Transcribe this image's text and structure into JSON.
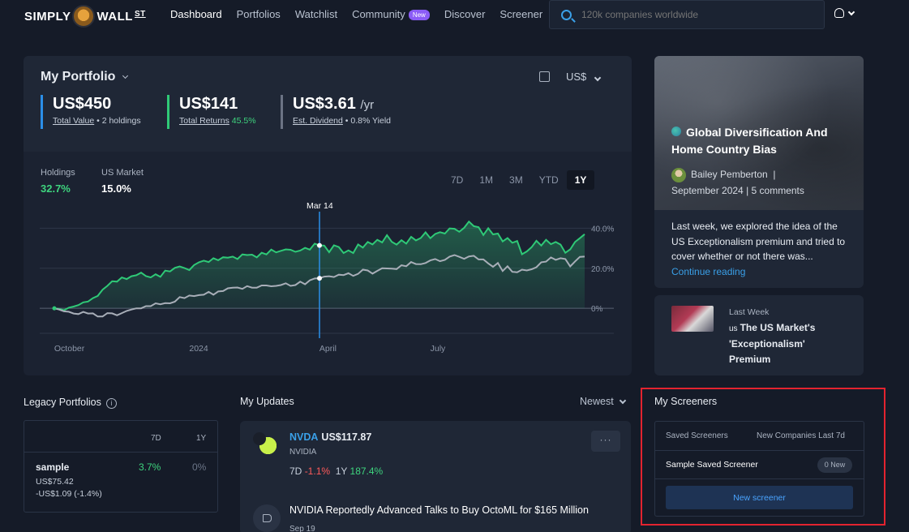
{
  "nav": {
    "logo_left": "SIMPLY",
    "logo_right": "WALL",
    "logo_st": "ST",
    "links": [
      "Dashboard",
      "Portfolios",
      "Watchlist",
      "Community",
      "Discover",
      "Screener"
    ],
    "community_badge": "New",
    "search_placeholder": "120k companies worldwide"
  },
  "portfolio": {
    "title": "My Portfolio",
    "currency": "US$",
    "total_value": "US$450",
    "total_value_label": "Total Value",
    "holdings_count": "• 2 holdings",
    "total_returns": "US$141",
    "total_returns_label": "Total Returns",
    "total_returns_pct": "45.5%",
    "dividend": "US$3.61",
    "dividend_suffix": "/yr",
    "dividend_label": "Est. Dividend",
    "dividend_yield": "• 0.8% Yield",
    "holdings_label": "Holdings",
    "holdings_pct": "32.7%",
    "market_label": "US Market",
    "market_pct": "15.0%",
    "ranges": [
      "7D",
      "1M",
      "3M",
      "YTD",
      "1Y"
    ],
    "selected_range": "1Y"
  },
  "chart_data": {
    "type": "line",
    "x_tick_labels": [
      "October",
      "2024",
      "April",
      "July"
    ],
    "y_tick_labels": [
      "40.0%",
      "20.0%",
      "0%"
    ],
    "ylim": [
      -6,
      45
    ],
    "hover_label": "Mar 14",
    "hover_index": 55,
    "series": [
      {
        "name": "Holdings",
        "color": "#2fc977",
        "values": [
          0.0,
          -0.3,
          -1.0,
          0.3,
          0.9,
          1.6,
          3.0,
          3.4,
          5.1,
          6.2,
          9.3,
          11.2,
          13.5,
          13.3,
          15.4,
          14.6,
          16.0,
          16.5,
          17.8,
          16.1,
          15.4,
          17.0,
          15.7,
          18.8,
          18.4,
          20.2,
          20.9,
          20.1,
          19.1,
          21.6,
          23.0,
          23.8,
          23.1,
          25.0,
          24.0,
          25.5,
          25.3,
          25.8,
          24.6,
          26.9,
          26.6,
          26.8,
          25.4,
          27.7,
          26.9,
          29.3,
          27.9,
          28.7,
          29.4,
          29.2,
          28.2,
          28.8,
          30.2,
          29.3,
          32.3,
          31.4,
          31.3,
          28.0,
          31.5,
          30.6,
          27.6,
          28.9,
          27.6,
          31.9,
          30.3,
          33.1,
          31.9,
          34.2,
          32.9,
          36.5,
          33.2,
          31.8,
          34.0,
          32.3,
          35.7,
          33.9,
          35.1,
          37.9,
          35.0,
          37.1,
          38.0,
          37.3,
          39.9,
          39.7,
          38.2,
          40.2,
          43.3,
          41.0,
          40.5,
          36.6,
          40.0,
          36.9,
          37.3,
          33.4,
          35.1,
          32.7,
          33.6,
          27.0,
          28.4,
          30.5,
          33.7,
          31.3,
          34.2,
          32.0,
          33.1,
          31.8,
          27.7,
          29.4,
          33.1,
          35.0,
          37.0
        ]
      },
      {
        "name": "US Market",
        "color": "#a8aeb8",
        "values": [
          0.0,
          -0.6,
          -1.5,
          -1.7,
          -2.6,
          -2.9,
          -1.8,
          -2.6,
          -2.5,
          -4.1,
          -4.1,
          -2.4,
          -2.5,
          -3.5,
          -2.4,
          -1.3,
          -0.6,
          0.0,
          0.0,
          1.1,
          1.1,
          2.5,
          2.0,
          2.6,
          2.5,
          3.3,
          5.6,
          5.1,
          6.4,
          6.1,
          6.6,
          6.8,
          8.2,
          6.8,
          8.4,
          8.6,
          10.0,
          10.3,
          10.4,
          9.7,
          11.1,
          10.3,
          10.3,
          11.4,
          11.4,
          11.0,
          11.2,
          11.6,
          12.5,
          11.2,
          11.6,
          13.3,
          12.0,
          14.0,
          14.9,
          15.0,
          15.8,
          16.0,
          15.6,
          16.8,
          16.6,
          17.5,
          16.2,
          17.2,
          19.3,
          18.9,
          17.3,
          18.7,
          20.0,
          19.9,
          19.8,
          19.6,
          21.5,
          21.0,
          23.1,
          22.1,
          22.0,
          22.6,
          23.9,
          24.6,
          23.5,
          24.2,
          25.8,
          26.6,
          25.7,
          24.7,
          25.9,
          26.2,
          24.4,
          24.4,
          22.4,
          20.7,
          22.6,
          18.6,
          21.0,
          18.2,
          18.0,
          19.3,
          18.9,
          19.5,
          20.5,
          23.0,
          23.3,
          25.4,
          24.2,
          25.0,
          24.6,
          20.9,
          23.4,
          25.7,
          25.8
        ]
      }
    ]
  },
  "article": {
    "title": "Global Diversification And Home Country Bias",
    "author": "Bailey Pemberton",
    "meta": "September 2024  |  5 comments",
    "excerpt": "Last week, we explored the idea of the US Exceptionalism premium and tried to cover whether or not there was...",
    "link": "Continue reading"
  },
  "article2": {
    "date": "Last Week",
    "flag": "us",
    "title": "The US Market's 'Exceptionalism' Premium"
  },
  "legacy": {
    "title": "Legacy Portfolios",
    "col_7d": "7D",
    "col_1y": "1Y",
    "row_name": "sample",
    "row_value": "US$75.42",
    "row_change": "-US$1.09 (-1.4%)",
    "row_7d": "3.7%",
    "row_1y": "0%"
  },
  "updates": {
    "title": "My Updates",
    "sort": "Newest",
    "ticker": "NVDA",
    "price": "US$117.87",
    "company": "NVIDIA",
    "perf_7d_label": "7D",
    "perf_7d": "-1.1%",
    "perf_1y_label": "1Y",
    "perf_1y": "187.4%",
    "more": "···",
    "news_title": "NVIDIA Reportedly Advanced Talks to Buy OctoML for $165 Million",
    "news_date": "Sep 19"
  },
  "screeners": {
    "title": "My Screeners",
    "col_saved": "Saved Screeners",
    "col_new": "New Companies Last 7d",
    "item": "Sample Saved Screener",
    "item_badge": "0 New",
    "new_button": "New screener"
  }
}
